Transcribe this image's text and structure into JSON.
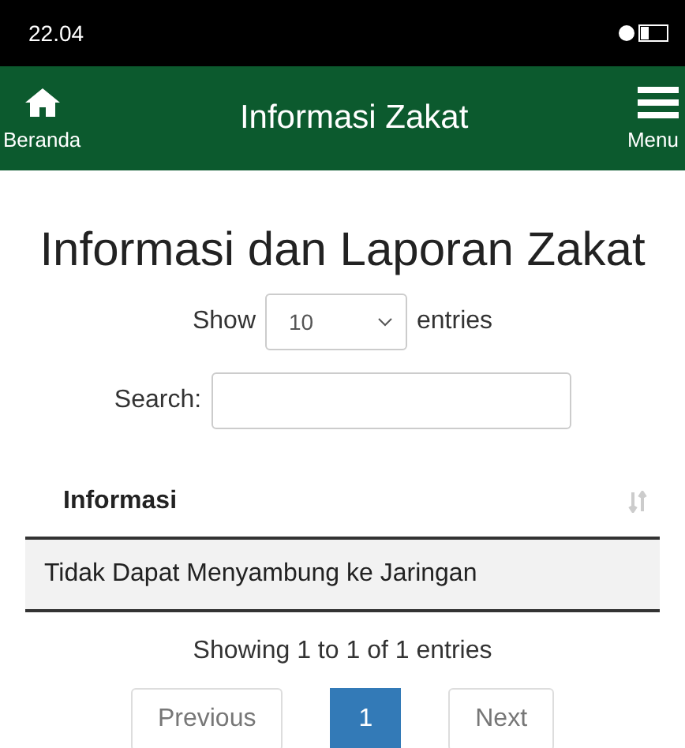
{
  "status_bar": {
    "time": "22.04"
  },
  "header": {
    "home_label": "Beranda",
    "title": "Informasi Zakat",
    "menu_label": "Menu"
  },
  "page_title": "Informasi dan Laporan Zakat",
  "length": {
    "label_before": "Show",
    "value": "10",
    "label_after": "entries"
  },
  "search": {
    "label": "Search:"
  },
  "table": {
    "columns": [
      {
        "label": "Informasi"
      }
    ],
    "rows": [
      {
        "cells": [
          "Tidak Dapat Menyambung ke Jaringan"
        ]
      }
    ]
  },
  "info": "Showing 1 to 1 of 1 entries",
  "pagination": [
    {
      "label": "Previous",
      "kind": "nav",
      "disabled": true,
      "selected": false
    },
    {
      "label": "1",
      "kind": "page",
      "disabled": false,
      "selected": true
    },
    {
      "label": "Next",
      "kind": "nav",
      "disabled": true,
      "selected": false
    }
  ]
}
